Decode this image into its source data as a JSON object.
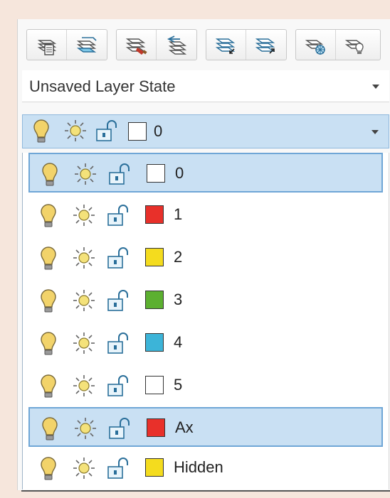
{
  "toolbar": {
    "groups": [
      {
        "buttons": [
          {
            "icon": "layer-properties-icon"
          },
          {
            "icon": "set-current-layer-icon"
          }
        ]
      },
      {
        "buttons": [
          {
            "icon": "match-layer-icon"
          },
          {
            "icon": "previous-layer-icon"
          }
        ]
      },
      {
        "buttons": [
          {
            "icon": "isolate-layer-icon"
          },
          {
            "icon": "unisolate-layer-icon"
          }
        ]
      },
      {
        "buttons": [
          {
            "icon": "freeze-layer-icon"
          },
          {
            "icon": "off-layer-icon"
          }
        ]
      }
    ]
  },
  "layer_state": {
    "value": "Unsaved Layer State"
  },
  "current_layer": {
    "name": "0",
    "color": "#ffffff"
  },
  "layers": [
    {
      "name": "0",
      "color": "#ffffff",
      "selected": true
    },
    {
      "name": "1",
      "color": "#e8302a",
      "selected": false
    },
    {
      "name": "2",
      "color": "#f4dc1e",
      "selected": false
    },
    {
      "name": "3",
      "color": "#5cb030",
      "selected": false
    },
    {
      "name": "4",
      "color": "#3cb4d8",
      "selected": false
    },
    {
      "name": "5",
      "color": "#ffffff",
      "selected": false
    },
    {
      "name": "Ax",
      "color": "#e8302a",
      "selected": true
    },
    {
      "name": "Hidden",
      "color": "#f4dc1e",
      "selected": false
    }
  ],
  "colors": {
    "selection": "#c9e0f3",
    "selection_border": "#6fa6d6"
  }
}
